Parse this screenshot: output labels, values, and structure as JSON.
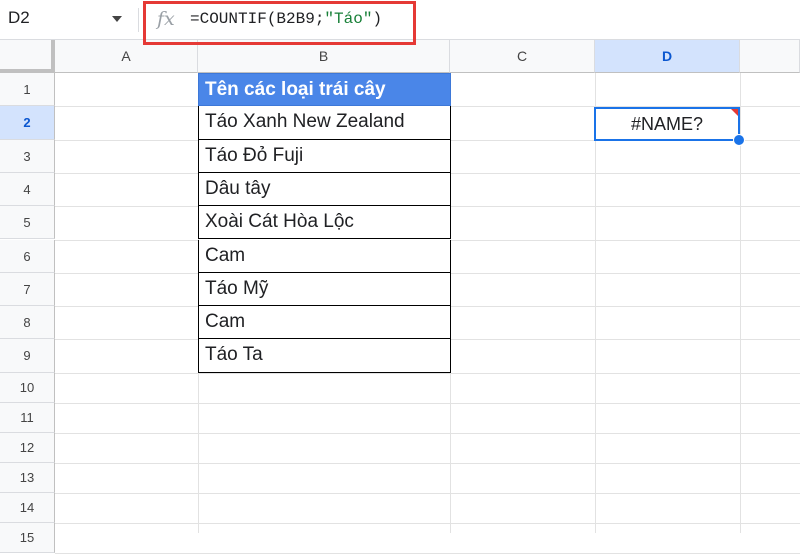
{
  "namebox": "D2",
  "formula": {
    "prefix": "=COUNTIF(B2B9;",
    "string": "\"Táo\"",
    "suffix": ")"
  },
  "columns": [
    "A",
    "B",
    "C",
    "D"
  ],
  "rows": [
    "1",
    "2",
    "3",
    "4",
    "5",
    "6",
    "7",
    "8",
    "9",
    "10",
    "11",
    "12",
    "13",
    "14",
    "15"
  ],
  "column_b": [
    "Tên các loại trái cây",
    "Táo Xanh New Zealand",
    "Táo Đỏ Fuji",
    "Dâu tây",
    "Xoài Cát Hòa Lộc",
    "Cam",
    "Táo Mỹ",
    "Cam",
    "Táo Ta"
  ],
  "d2_value": "#NAME?",
  "colors": {
    "header_fill": "#4a86e8",
    "highlight": "#e53935",
    "selection": "#1a73e8"
  }
}
